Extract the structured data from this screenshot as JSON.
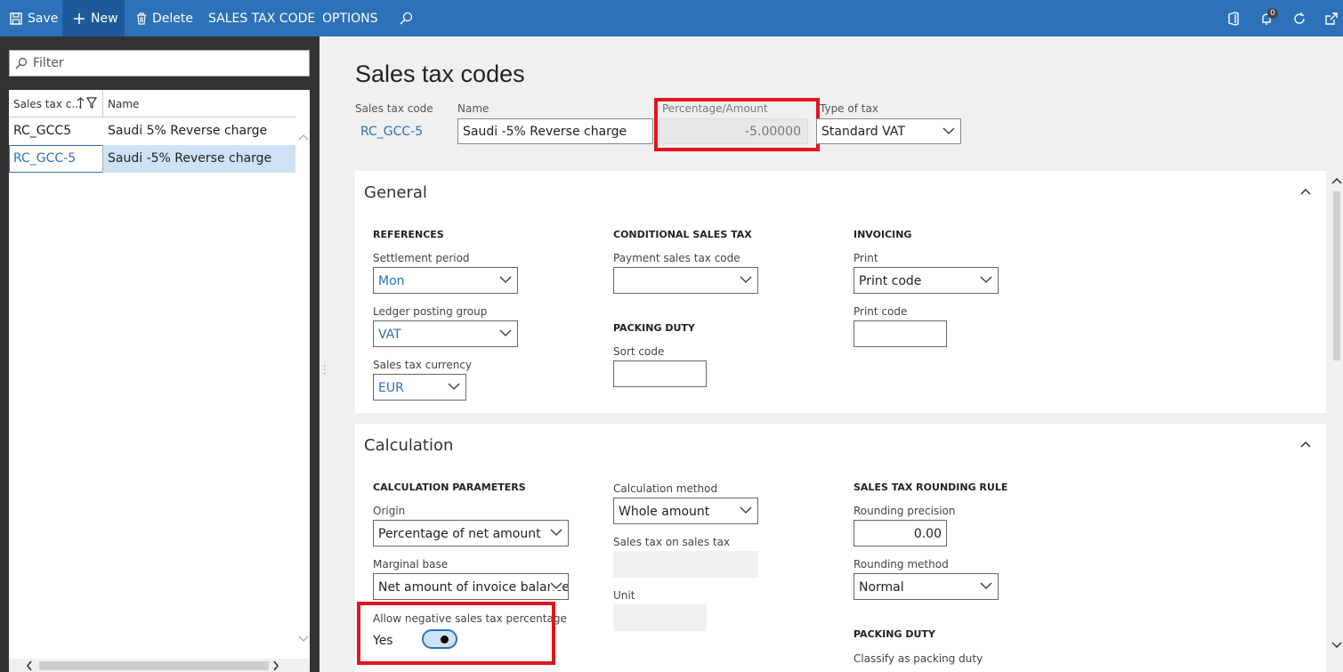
{
  "toolbar": {
    "save": "Save",
    "new": "New",
    "delete": "Delete",
    "sales_tax_code": "SALES TAX CODE",
    "options": "OPTIONS",
    "notification_count": "0"
  },
  "filter": {
    "placeholder": "Filter"
  },
  "grid": {
    "col1": "Sales tax c...",
    "col2": "Name",
    "rows": [
      {
        "code": "RC_GCC5",
        "name": "Saudi 5% Reverse charge"
      },
      {
        "code": "RC_GCC-5",
        "name": "Saudi -5% Reverse charge"
      }
    ]
  },
  "page": {
    "title": "Sales tax codes"
  },
  "header": {
    "code_label": "Sales tax code",
    "code_value": "RC_GCC-5",
    "name_label": "Name",
    "name_value": "Saudi -5% Reverse charge",
    "pct_label": "Percentage/Amount",
    "pct_value": "-5.00000",
    "type_label": "Type of tax",
    "type_value": "Standard VAT"
  },
  "general": {
    "title": "General",
    "references": "REFERENCES",
    "settlement_label": "Settlement period",
    "settlement_value": "Mon",
    "ledger_label": "Ledger posting group",
    "ledger_value": "VAT",
    "currency_label": "Sales tax currency",
    "currency_value": "EUR",
    "conditional": "CONDITIONAL SALES TAX",
    "payment_label": "Payment sales tax code",
    "payment_value": "",
    "packing": "PACKING DUTY",
    "sort_label": "Sort code",
    "sort_value": "",
    "invoicing": "INVOICING",
    "print_label": "Print",
    "print_value": "Print code",
    "printcode_label": "Print code",
    "printcode_value": ""
  },
  "calculation": {
    "title": "Calculation",
    "params": "CALCULATION PARAMETERS",
    "origin_label": "Origin",
    "origin_value": "Percentage of net amount",
    "marginal_label": "Marginal base",
    "marginal_value": "Net amount of invoice balance",
    "allow_neg_label": "Allow negative sales tax percentage",
    "allow_neg_value": "Yes",
    "method_label": "Calculation method",
    "method_value": "Whole amount",
    "tax_on_tax_label": "Sales tax on sales tax",
    "unit_label": "Unit",
    "rounding_rule": "SALES TAX ROUNDING RULE",
    "precision_label": "Rounding precision",
    "precision_value": "0.00",
    "rmethod_label": "Rounding method",
    "rmethod_value": "Normal",
    "packing": "PACKING DUTY",
    "classify_label": "Classify as packing duty"
  },
  "colors": {
    "accent": "#2d71b8",
    "highlight": "#e0161f",
    "toolbar_dark": "#1d5a9b"
  }
}
